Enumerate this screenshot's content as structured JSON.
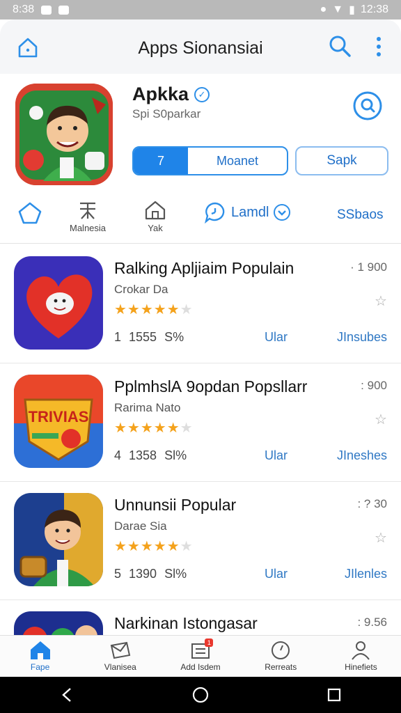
{
  "status_bar": {
    "time_left": "8:38",
    "time_right": "12:38"
  },
  "topbar": {
    "title": "Apps Sionansiai"
  },
  "app": {
    "name": "Apkka",
    "subtitle": "Spi S0parkar",
    "primary_button_icon": "7",
    "primary_button_label": "Moanet",
    "secondary_button_label": "Sapk"
  },
  "quicknav": {
    "items": [
      {
        "label": "",
        "icon": "star-outline-icon"
      },
      {
        "label": "Malnesia",
        "icon": "building-icon"
      },
      {
        "label": "Yak",
        "icon": "house-icon"
      }
    ],
    "dropdown_label": "Lamdl",
    "right_label": "SSbaos"
  },
  "apps": [
    {
      "title": "Ralking Apljiaim Populain",
      "developer": "Crokar Da",
      "rating": 4.5,
      "installs": "1 1555",
      "percent": "S%",
      "price": "1 900",
      "action": "Ular",
      "link": "JInsubes"
    },
    {
      "title": "PplmhslА 9opdan Popsllarr",
      "developer": "Rarima Nato",
      "rating": 4.5,
      "installs": "4 1358",
      "percent": "Sl%",
      "price": "900",
      "action": "Ular",
      "link": "JIneshes"
    },
    {
      "title": "Unnunsii Popular",
      "developer": "Darae Sia",
      "rating": 4.5,
      "installs": "5 1390",
      "percent": "Sl%",
      "price": "? 30",
      "action": "Ular",
      "link": "JIlenles"
    },
    {
      "title": "Narkinan Istongasar",
      "developer": "",
      "rating": 0,
      "installs": "",
      "percent": "",
      "price": "9.56",
      "action": "",
      "link": ""
    }
  ],
  "bottom_nav": [
    {
      "label": "Fape",
      "icon": "home-icon",
      "active": true
    },
    {
      "label": "Vlanisea",
      "icon": "mail-icon",
      "active": false
    },
    {
      "label": "Add Isdem",
      "icon": "list-badge-icon",
      "active": false,
      "badge": "1"
    },
    {
      "label": "Rerreats",
      "icon": "clock-icon",
      "active": false
    },
    {
      "label": "Hinefiets",
      "icon": "person-icon",
      "active": false
    }
  ],
  "colors": {
    "accent": "#1f84e8",
    "star": "#f4a21c",
    "link": "#2f78c4"
  }
}
